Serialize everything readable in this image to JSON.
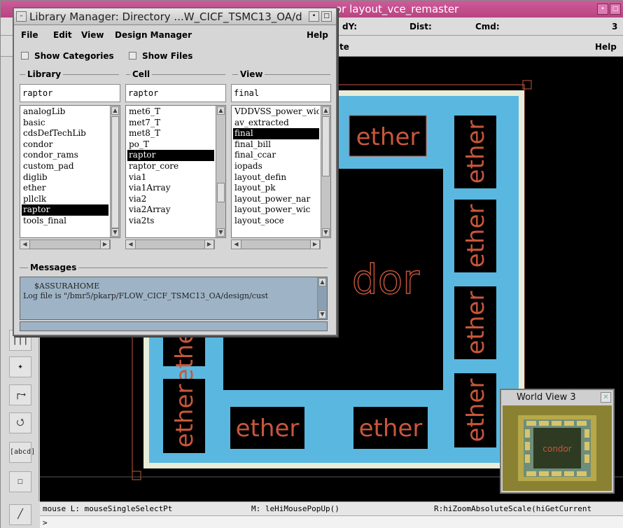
{
  "editor": {
    "title": "or layout_vce_remaster",
    "status": {
      "dy_label": "dY:",
      "dist_label": "Dist:",
      "cmd_label": "Cmd:",
      "count": "3"
    },
    "menu": {
      "fragment": "te",
      "help": "Help"
    },
    "toolbar": {
      "tools": [
        "|||",
        "✦",
        "┌→",
        "⭯",
        "[abcd]",
        "☐",
        "╱"
      ]
    },
    "layout": {
      "block_label": "ether",
      "center_label": "dor"
    },
    "cmdline": {
      "mouse_left": "mouse L: mouseSingleSelectPt",
      "mouse_middle": "M: leHiMousePopUp()",
      "mouse_right": "R:hiZoomAbsoluteScale(hiGetCurrent"
    },
    "prompt": ">"
  },
  "library_manager": {
    "title": "Library Manager: Directory ...W_CICF_TSMC13_OA/d",
    "menu": {
      "file": "File",
      "edit": "Edit",
      "view": "View",
      "design_manager": "Design Manager",
      "help": "Help"
    },
    "show_categories": "Show Categories",
    "show_files": "Show Files",
    "library": {
      "label": "Library",
      "value": "raptor",
      "items": [
        "analogLib",
        "basic",
        "cdsDefTechLib",
        "condor",
        "condor_rams",
        "custom_pad",
        "diglib",
        "ether",
        "pllclk",
        "raptor",
        "tools_final"
      ],
      "selected": "raptor"
    },
    "cell": {
      "label": "Cell",
      "value": "raptor",
      "items": [
        "met6_T",
        "met7_T",
        "met8_T",
        "po_T",
        "raptor",
        "raptor_core",
        "via1",
        "via1Array",
        "via2",
        "via2Array",
        "via2ts"
      ],
      "selected": "raptor"
    },
    "view": {
      "label": "View",
      "value": "final",
      "items": [
        "VDDVSS_power_wic",
        "av_extracted",
        "final",
        "final_bill",
        "final_ccar",
        "iopads",
        "layout_defin",
        "layout_pk",
        "layout_power_nar",
        "layout_power_wic",
        "layout_soce"
      ],
      "selected": "final"
    },
    "messages": {
      "label": "Messages",
      "lines": [
        "$ASSURAHOME",
        "Log file is \"/bmr5/pkarp/FLOW_CICF_TSMC13_OA/design/cust"
      ]
    }
  },
  "world_view": {
    "title": "World View 3",
    "label": "condor"
  },
  "colors": {
    "editor_title": "#c44e8c",
    "layout_ring": "#5ab8e0",
    "layout_text": "#c8563a",
    "canvas": "#000000",
    "message_bg": "#9eb4c6"
  }
}
